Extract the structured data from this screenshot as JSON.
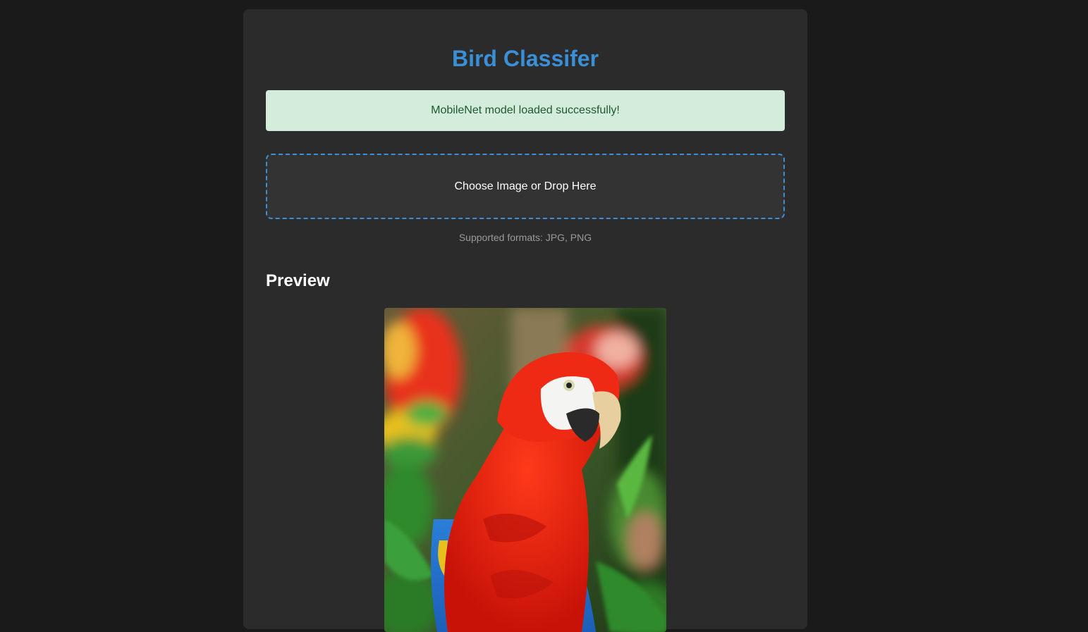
{
  "app": {
    "title": "Bird Classifer"
  },
  "status": {
    "message": "MobileNet model loaded successfully!",
    "color": "#d4ecdb"
  },
  "upload": {
    "label": "Choose Image or Drop Here",
    "formats_note": "Supported formats: JPG, PNG",
    "border_color": "#3a8fd6"
  },
  "preview": {
    "heading": "Preview",
    "image_subject": "scarlet-macaw-photo"
  },
  "colors": {
    "background": "#1a1a1a",
    "card": "#2b2b2b",
    "accent": "#3a8fd6"
  }
}
